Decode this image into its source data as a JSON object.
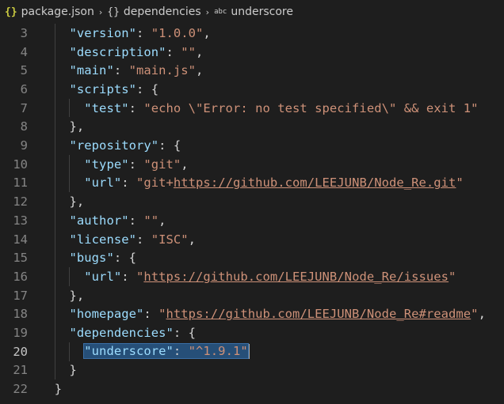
{
  "breadcrumb": {
    "items": [
      {
        "icon": "json-file-icon",
        "glyph": "{}",
        "label": "package.json"
      },
      {
        "icon": "object-icon",
        "glyph": "{}",
        "label": "dependencies"
      },
      {
        "icon": "string-icon",
        "glyph": "abc",
        "label": "underscore"
      }
    ],
    "separator": "›"
  },
  "editor": {
    "lines": [
      {
        "n": "3",
        "indent": "    ",
        "tokens": [
          [
            "k",
            "\"version\""
          ],
          [
            "p",
            ": "
          ],
          [
            "s",
            "\"1.0.0\""
          ],
          [
            "p",
            ","
          ]
        ]
      },
      {
        "n": "4",
        "indent": "    ",
        "tokens": [
          [
            "k",
            "\"description\""
          ],
          [
            "p",
            ": "
          ],
          [
            "s",
            "\"\""
          ],
          [
            "p",
            ","
          ]
        ]
      },
      {
        "n": "5",
        "indent": "    ",
        "tokens": [
          [
            "k",
            "\"main\""
          ],
          [
            "p",
            ": "
          ],
          [
            "s",
            "\"main.js\""
          ],
          [
            "p",
            ","
          ]
        ]
      },
      {
        "n": "6",
        "indent": "    ",
        "tokens": [
          [
            "k",
            "\"scripts\""
          ],
          [
            "p",
            ": {"
          ]
        ]
      },
      {
        "n": "7",
        "indent": "      ",
        "tokens": [
          [
            "k",
            "\"test\""
          ],
          [
            "p",
            ": "
          ],
          [
            "s",
            "\"echo \\\"Error: no test specified\\\" && exit 1\""
          ]
        ]
      },
      {
        "n": "8",
        "indent": "    ",
        "tokens": [
          [
            "p",
            "},"
          ]
        ]
      },
      {
        "n": "9",
        "indent": "    ",
        "tokens": [
          [
            "k",
            "\"repository\""
          ],
          [
            "p",
            ": {"
          ]
        ]
      },
      {
        "n": "10",
        "indent": "      ",
        "tokens": [
          [
            "k",
            "\"type\""
          ],
          [
            "p",
            ": "
          ],
          [
            "s",
            "\"git\""
          ],
          [
            "p",
            ","
          ]
        ]
      },
      {
        "n": "11",
        "indent": "      ",
        "tokens": [
          [
            "k",
            "\"url\""
          ],
          [
            "p",
            ": "
          ],
          [
            "s",
            "\"git+"
          ],
          [
            "su",
            "https://github.com/LEEJUNB/Node_Re.git"
          ],
          [
            "s",
            "\""
          ]
        ]
      },
      {
        "n": "12",
        "indent": "    ",
        "tokens": [
          [
            "p",
            "},"
          ]
        ]
      },
      {
        "n": "13",
        "indent": "    ",
        "tokens": [
          [
            "k",
            "\"author\""
          ],
          [
            "p",
            ": "
          ],
          [
            "s",
            "\"\""
          ],
          [
            "p",
            ","
          ]
        ]
      },
      {
        "n": "14",
        "indent": "    ",
        "tokens": [
          [
            "k",
            "\"license\""
          ],
          [
            "p",
            ": "
          ],
          [
            "s",
            "\"ISC\""
          ],
          [
            "p",
            ","
          ]
        ]
      },
      {
        "n": "15",
        "indent": "    ",
        "tokens": [
          [
            "k",
            "\"bugs\""
          ],
          [
            "p",
            ": {"
          ]
        ]
      },
      {
        "n": "16",
        "indent": "      ",
        "tokens": [
          [
            "k",
            "\"url\""
          ],
          [
            "p",
            ": "
          ],
          [
            "s",
            "\""
          ],
          [
            "su",
            "https://github.com/LEEJUNB/Node_Re/issues"
          ],
          [
            "s",
            "\""
          ]
        ]
      },
      {
        "n": "17",
        "indent": "    ",
        "tokens": [
          [
            "p",
            "},"
          ]
        ]
      },
      {
        "n": "18",
        "indent": "    ",
        "tokens": [
          [
            "k",
            "\"homepage\""
          ],
          [
            "p",
            ": "
          ],
          [
            "s",
            "\""
          ],
          [
            "su",
            "https://github.com/LEEJUNB/Node_Re#readme"
          ],
          [
            "s",
            "\""
          ],
          [
            "p",
            ","
          ]
        ]
      },
      {
        "n": "19",
        "indent": "    ",
        "tokens": [
          [
            "k",
            "\"dependencies\""
          ],
          [
            "p",
            ": {"
          ]
        ]
      },
      {
        "n": "20",
        "indent": "      ",
        "tokens": [
          [
            "sel-k",
            "\"underscore\""
          ],
          [
            "sel-p",
            ": "
          ],
          [
            "sel-s",
            "\"^1.9.1\""
          ],
          [
            "cursor",
            ""
          ]
        ],
        "active": true
      },
      {
        "n": "21",
        "indent": "    ",
        "tokens": [
          [
            "p",
            "}"
          ]
        ]
      },
      {
        "n": "22",
        "indent": "  ",
        "tokens": [
          [
            "p",
            "}"
          ]
        ]
      }
    ]
  },
  "colors": {
    "background": "#1e1e1e",
    "key": "#9cdcfe",
    "string": "#ce9178",
    "punctuation": "#d4d4d4",
    "line_number": "#858585",
    "selection": "#264f78"
  }
}
